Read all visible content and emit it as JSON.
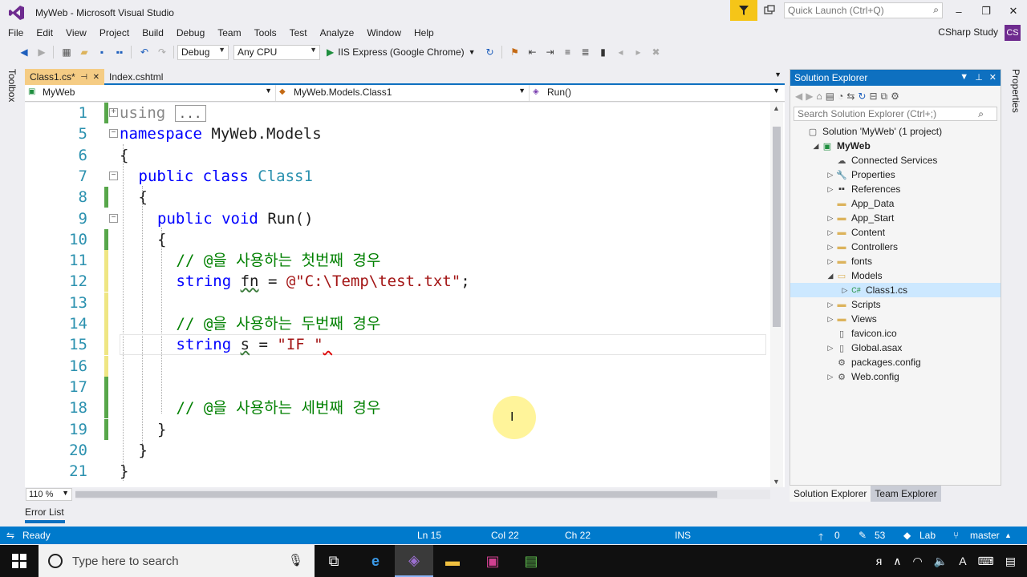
{
  "window": {
    "title": "MyWeb - Microsoft Visual Studio",
    "quick_launch_placeholder": "Quick Launch (Ctrl+Q)",
    "user": "CSharp Study",
    "avatar_initials": "CS"
  },
  "menu": [
    "File",
    "Edit",
    "View",
    "Project",
    "Build",
    "Debug",
    "Team",
    "Tools",
    "Test",
    "Analyze",
    "Window",
    "Help"
  ],
  "toolbar": {
    "config": "Debug",
    "platform": "Any CPU",
    "run_target": "IIS Express (Google Chrome)"
  },
  "side_labels": {
    "left": "Toolbox",
    "right": "Properties"
  },
  "tabs": [
    {
      "label": "Class1.cs*",
      "pin": "⊣",
      "close": "✕"
    },
    {
      "label": "Index.cshtml"
    }
  ],
  "navbar": {
    "project": "MyWeb",
    "class": "MyWeb.Models.Class1",
    "member": "Run()"
  },
  "code": {
    "line_numbers": [
      "1",
      "5",
      "6",
      "7",
      "8",
      "9",
      "10",
      "11",
      "12",
      "13",
      "14",
      "15",
      "16",
      "17",
      "18",
      "19",
      "20",
      "21"
    ],
    "using_kw": "using",
    "collapsed": "...",
    "namespace_kw": "namespace",
    "namespace_name": "MyWeb.Models",
    "open_brace": "{",
    "close_brace": "}",
    "public_kw": "public",
    "class_kw": "class",
    "class_name": "Class1",
    "void_kw": "void",
    "method": "Run()",
    "comment1": "// @을 사용하는 첫번째 경우",
    "comment2": "// @을 사용하는 두번째 경우",
    "comment3": "// @을 사용하는 세번째 경우",
    "string_kw": "string",
    "var_fn": "fn",
    "var_s": "s",
    "eq": "=",
    "str1": "@\"C:\\Temp\\test.txt\"",
    "semi": ";",
    "str2": "\"IF \"",
    "squiggle_tail": " "
  },
  "zoom": "110 %",
  "solution_explorer": {
    "title": "Solution Explorer",
    "search_placeholder": "Search Solution Explorer (Ctrl+;)",
    "nodes": [
      {
        "label": "Solution 'MyWeb' (1 project)",
        "icon": "solution-icon",
        "level": 0,
        "exp": ""
      },
      {
        "label": "MyWeb",
        "icon": "project-icon",
        "level": 1,
        "exp": "◢",
        "bold": true
      },
      {
        "label": "Connected Services",
        "icon": "cloud-icon",
        "level": 2,
        "exp": ""
      },
      {
        "label": "Properties",
        "icon": "wrench-icon",
        "level": 2,
        "exp": "▷"
      },
      {
        "label": "References",
        "icon": "references-icon",
        "level": 2,
        "exp": "▷"
      },
      {
        "label": "App_Data",
        "icon": "folder-icon",
        "level": 2,
        "exp": ""
      },
      {
        "label": "App_Start",
        "icon": "folder-icon",
        "level": 2,
        "exp": "▷"
      },
      {
        "label": "Content",
        "icon": "folder-icon",
        "level": 2,
        "exp": "▷"
      },
      {
        "label": "Controllers",
        "icon": "folder-icon",
        "level": 2,
        "exp": "▷"
      },
      {
        "label": "fonts",
        "icon": "folder-icon",
        "level": 2,
        "exp": "▷"
      },
      {
        "label": "Models",
        "icon": "folder-open-icon",
        "level": 2,
        "exp": "◢"
      },
      {
        "label": "Class1.cs",
        "icon": "csharp-file-icon",
        "level": 3,
        "exp": "▷",
        "selected": true
      },
      {
        "label": "Scripts",
        "icon": "folder-icon",
        "level": 2,
        "exp": "▷"
      },
      {
        "label": "Views",
        "icon": "folder-icon",
        "level": 2,
        "exp": "▷"
      },
      {
        "label": "favicon.ico",
        "icon": "file-icon",
        "level": 2,
        "exp": ""
      },
      {
        "label": "Global.asax",
        "icon": "file-icon",
        "level": 2,
        "exp": "▷"
      },
      {
        "label": "packages.config",
        "icon": "config-icon",
        "level": 2,
        "exp": ""
      },
      {
        "label": "Web.config",
        "icon": "config-icon",
        "level": 2,
        "exp": "▷"
      }
    ],
    "tabs": [
      "Solution Explorer",
      "Team Explorer"
    ]
  },
  "error_list": "Error List",
  "status": {
    "ready": "Ready",
    "ln": "Ln 15",
    "col": "Col 22",
    "ch": "Ch 22",
    "ins": "INS",
    "up": "0",
    "pencil": "53",
    "repo": "Lab",
    "branch": "master"
  },
  "taskbar": {
    "search_placeholder": "Type here to search"
  },
  "colors": {
    "accent": "#007acc",
    "active_tab": "#f5cc84",
    "keyword": "#0000ff",
    "type": "#2b91af",
    "comment": "#008000",
    "string": "#a31515"
  }
}
